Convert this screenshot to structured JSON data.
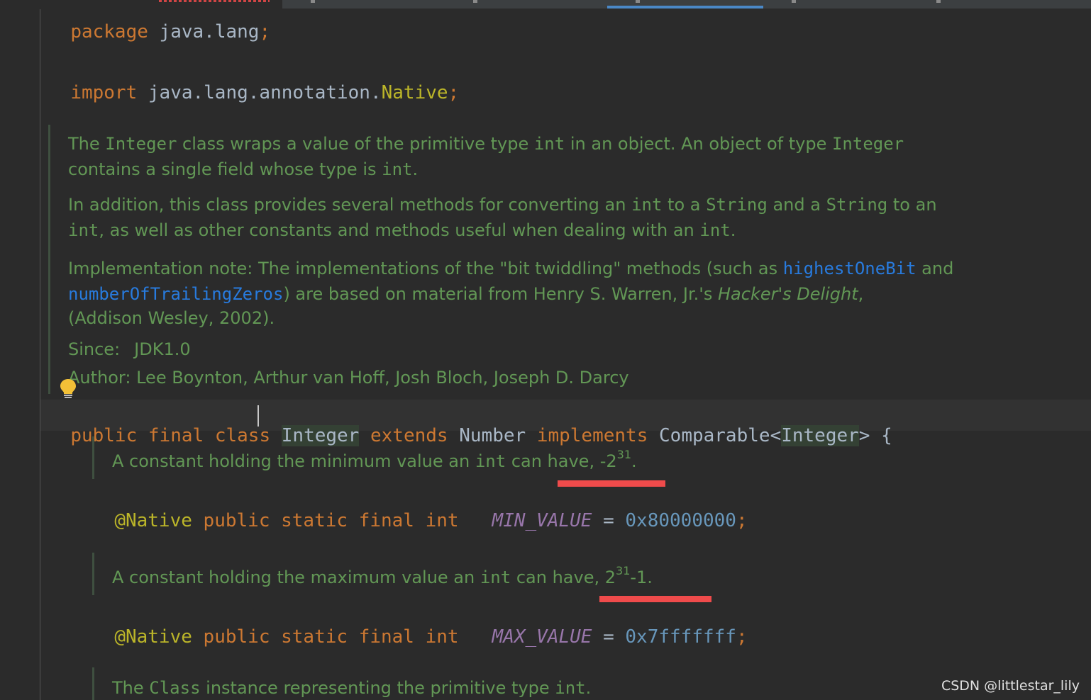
{
  "editor": {
    "package_line": {
      "keyword": "package",
      "name": "java.lang",
      "semi": ";"
    },
    "import_line": {
      "keyword": "import",
      "path": "java.lang.annotation.",
      "cls": "Native",
      "semi": ";"
    },
    "class_doc": {
      "p1": {
        "a": "The ",
        "b": "Integer",
        "c": " class wraps a value of the primitive type ",
        "d": "int",
        "e": " in an object. An object of type ",
        "f": "Integer"
      },
      "p1l2": {
        "a": "contains a single field whose type is ",
        "b": "int",
        "c": "."
      },
      "p2": {
        "a": "In addition, this class provides several methods for converting an ",
        "b": "int",
        "c": " to a ",
        "d": "String",
        "e": " and a ",
        "f": "String",
        "g": " to an"
      },
      "p2l2": {
        "a": "int",
        "b": ", as well as other constants and methods useful when dealing with an ",
        "c": "int",
        "d": "."
      },
      "p3": {
        "a": "Implementation note: The implementations of the \"bit twiddling\" methods (such as ",
        "link1": "highestOneBit",
        "b": " and"
      },
      "p3l2": {
        "link2": "numberOfTrailingZeros",
        "a": ") are based on material from Henry S. Warren, Jr.'s ",
        "book": "Hacker's Delight",
        "b": ","
      },
      "p3l3": "(Addison Wesley, 2002).",
      "since_label": "Since:",
      "since_value": "JDK1.0",
      "author_label": "Author:",
      "author_value": "Lee Boynton, Arthur van Hoff, Josh Bloch, Joseph D. Darcy"
    },
    "class_decl": {
      "public": "public",
      "final": "final",
      "class": "class",
      "name": "Integer",
      "extends": "extends",
      "parent": "Number",
      "implements": "implements",
      "iface": "Comparable",
      "lt": "<",
      "generic": "Integer",
      "gt": ">",
      "brace": "{"
    },
    "min_doc": {
      "a": "A constant holding the minimum value an ",
      "b": "int",
      "c": " can have, -2",
      "sup": "31",
      "d": "."
    },
    "min_decl": {
      "annotation": "@Native",
      "mods": "public static final int",
      "name": "MIN_VALUE",
      "eq": "=",
      "value": "0x80000000",
      "semi": ";"
    },
    "max_doc": {
      "a": "A constant holding the maximum value an ",
      "b": "int",
      "c": " can have, 2",
      "sup": "31",
      "d": "-1."
    },
    "max_decl": {
      "annotation": "@Native",
      "mods": "public static final int",
      "name": "MAX_VALUE",
      "eq": "=",
      "value": "0x7fffffff",
      "semi": ";"
    },
    "type_doc": {
      "a": "The ",
      "b": "Class",
      "c": " instance representing the primitive type ",
      "d": "int",
      "e": "."
    }
  },
  "watermark": "CSDN @littlestar_lily",
  "colors": {
    "background": "#2b2b2b",
    "keyword": "#cc7832",
    "doc": "#629755",
    "link": "#287bde",
    "constant": "#9876aa",
    "number": "#6897bb",
    "annotation": "#bbb529",
    "highlight_underline": "#ef4b4b"
  }
}
